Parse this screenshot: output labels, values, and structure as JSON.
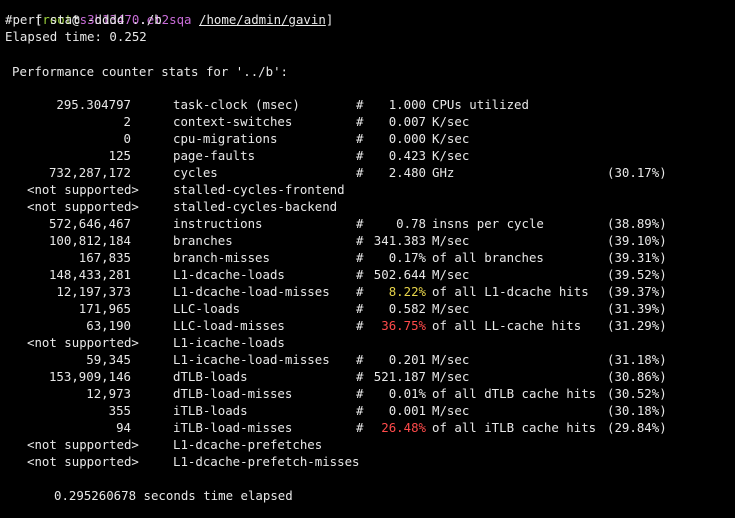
{
  "prompt": {
    "user": "root",
    "at": "@",
    "host": "s3h13470.et2sqa",
    "path": "/home/admin/gavin"
  },
  "command": "#perf stat -dddd ../b",
  "elapsed": "Elapsed time: 0.252",
  "header": "Performance counter stats for '../b':",
  "rows": [
    {
      "value": "295.304797",
      "event": "task-clock (msec)",
      "hash": "#",
      "metric": "1.000",
      "unit": "CPUs utilized",
      "pct": "",
      "color": ""
    },
    {
      "value": "2",
      "event": "context-switches",
      "hash": "#",
      "metric": "0.007",
      "unit": "K/sec",
      "pct": "",
      "color": ""
    },
    {
      "value": "0",
      "event": "cpu-migrations",
      "hash": "#",
      "metric": "0.000",
      "unit": "K/sec",
      "pct": "",
      "color": ""
    },
    {
      "value": "125",
      "event": "page-faults",
      "hash": "#",
      "metric": "0.423",
      "unit": "K/sec",
      "pct": "",
      "color": ""
    },
    {
      "value": "732,287,172",
      "event": "cycles",
      "hash": "#",
      "metric": "2.480",
      "unit": "GHz",
      "pct": "(30.17%)",
      "color": ""
    },
    {
      "value": "<not supported>",
      "event": "stalled-cycles-frontend",
      "hash": "",
      "metric": "",
      "unit": "",
      "pct": "",
      "color": ""
    },
    {
      "value": "<not supported>",
      "event": "stalled-cycles-backend",
      "hash": "",
      "metric": "",
      "unit": "",
      "pct": "",
      "color": ""
    },
    {
      "value": "572,646,467",
      "event": "instructions",
      "hash": "#",
      "metric": "0.78",
      "unit": "insns per cycle",
      "pct": "(38.89%)",
      "color": ""
    },
    {
      "value": "100,812,184",
      "event": "branches",
      "hash": "#",
      "metric": "341.383",
      "unit": "M/sec",
      "pct": "(39.10%)",
      "color": ""
    },
    {
      "value": "167,835",
      "event": "branch-misses",
      "hash": "#",
      "metric": "0.17%",
      "unit": "of all branches",
      "pct": "(39.31%)",
      "color": ""
    },
    {
      "value": "148,433,281",
      "event": "L1-dcache-loads",
      "hash": "#",
      "metric": "502.644",
      "unit": "M/sec",
      "pct": "(39.52%)",
      "color": ""
    },
    {
      "value": "12,197,373",
      "event": "L1-dcache-load-misses",
      "hash": "#",
      "metric": "8.22%",
      "unit": "of all L1-dcache hits",
      "pct": "(39.37%)",
      "color": "yellow"
    },
    {
      "value": "171,965",
      "event": "LLC-loads",
      "hash": "#",
      "metric": "0.582",
      "unit": "M/sec",
      "pct": "(31.39%)",
      "color": ""
    },
    {
      "value": "63,190",
      "event": "LLC-load-misses",
      "hash": "#",
      "metric": "36.75%",
      "unit": "of all LL-cache hits",
      "pct": "(31.29%)",
      "color": "red"
    },
    {
      "value": "<not supported>",
      "event": "L1-icache-loads",
      "hash": "",
      "metric": "",
      "unit": "",
      "pct": "",
      "color": ""
    },
    {
      "value": "59,345",
      "event": "L1-icache-load-misses",
      "hash": "#",
      "metric": "0.201",
      "unit": "M/sec",
      "pct": "(31.18%)",
      "color": ""
    },
    {
      "value": "153,909,146",
      "event": "dTLB-loads",
      "hash": "#",
      "metric": "521.187",
      "unit": "M/sec",
      "pct": "(30.86%)",
      "color": ""
    },
    {
      "value": "12,973",
      "event": "dTLB-load-misses",
      "hash": "#",
      "metric": "0.01%",
      "unit": "of all dTLB cache hits",
      "pct": "(30.52%)",
      "color": ""
    },
    {
      "value": "355",
      "event": "iTLB-loads",
      "hash": "#",
      "metric": "0.001",
      "unit": "M/sec",
      "pct": "(30.18%)",
      "color": ""
    },
    {
      "value": "94",
      "event": "iTLB-load-misses",
      "hash": "#",
      "metric": "26.48%",
      "unit": "of all iTLB cache hits",
      "pct": "(29.84%)",
      "color": "red"
    },
    {
      "value": "<not supported>",
      "event": "L1-dcache-prefetches",
      "hash": "",
      "metric": "",
      "unit": "",
      "pct": "",
      "color": ""
    },
    {
      "value": "<not supported>",
      "event": "L1-dcache-prefetch-misses",
      "hash": "",
      "metric": "",
      "unit": "",
      "pct": "",
      "color": ""
    }
  ],
  "footer": "0.295260678 seconds time elapsed",
  "colors": {
    "yellow": "#e6d34a",
    "red": "#ff4a4a",
    "user": "#9bd23c",
    "host": "#c86cd8"
  }
}
